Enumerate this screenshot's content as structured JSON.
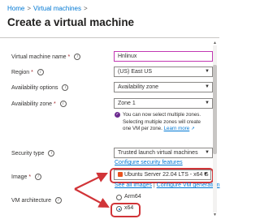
{
  "breadcrumb": {
    "home": "Home",
    "separator": ">",
    "current": "Virtual machines",
    "trail": ">"
  },
  "page": {
    "title": "Create a virtual machine"
  },
  "form": {
    "vm_name": {
      "label": "Virtual machine name",
      "required": "*",
      "value": "Hnlinux"
    },
    "region": {
      "label": "Region",
      "required": "*",
      "value": "(US) East US"
    },
    "availability_options": {
      "label": "Availability options",
      "value": "Availability zone"
    },
    "availability_zone": {
      "label": "Availability zone",
      "required": "*",
      "value": "Zone 1",
      "info_line1": "You can now select multiple zones.",
      "info_line2": "Selecting multiple zones will create",
      "info_line3": "one VM per zone.",
      "learn_more": "Learn more"
    },
    "security_type": {
      "label": "Security type",
      "value": "Trusted launch virtual machines",
      "link": "Configure security features"
    },
    "image": {
      "label": "Image",
      "required": "*",
      "value": "Ubuntu Server 22.04 LTS - x64 G",
      "link_all": "See all images",
      "link_sep": "|",
      "link_config": "Configure VM generation"
    },
    "vm_architecture": {
      "label": "VM architecture",
      "options": [
        {
          "label": "Arm64",
          "selected": false
        },
        {
          "label": "x64",
          "selected": true
        }
      ]
    }
  },
  "icons": {
    "info": "info-icon",
    "chevron": "chevron-down-icon",
    "check": "check-circle-icon",
    "ubuntu": "ubuntu-icon"
  },
  "colors": {
    "accent": "#0078d4",
    "highlight": "#d13438",
    "focus_border": "#c239b3"
  }
}
